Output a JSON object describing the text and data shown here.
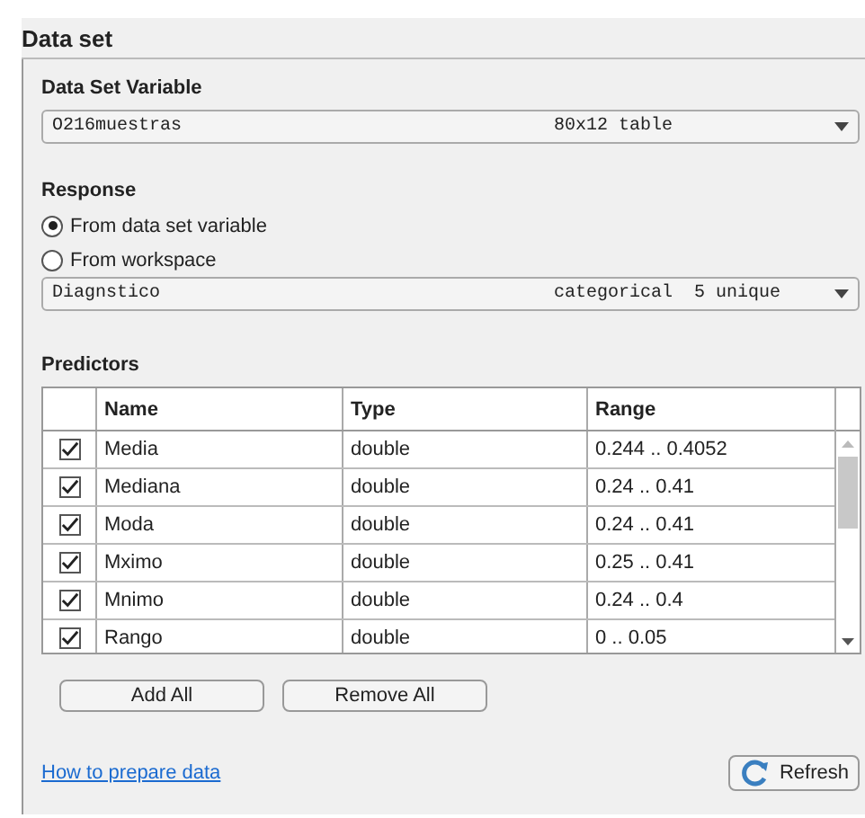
{
  "panel": {
    "title": "Data set"
  },
  "data_set_variable": {
    "label": "Data Set Variable",
    "value": "O216muestras",
    "info": "80x12 table"
  },
  "response": {
    "label": "Response",
    "options": [
      {
        "label": "From data set variable",
        "selected": true
      },
      {
        "label": "From workspace",
        "selected": false
      }
    ],
    "value": "Diagnstico",
    "info": "categorical  5 unique"
  },
  "predictors": {
    "label": "Predictors",
    "columns": [
      "Name",
      "Type",
      "Range"
    ],
    "rows": [
      {
        "checked": true,
        "name": "Media",
        "type": "double",
        "range": "0.244 .. 0.4052"
      },
      {
        "checked": true,
        "name": "Mediana",
        "type": "double",
        "range": "0.24 .. 0.41"
      },
      {
        "checked": true,
        "name": "Moda",
        "type": "double",
        "range": "0.24 .. 0.41"
      },
      {
        "checked": true,
        "name": "Mximo",
        "type": "double",
        "range": "0.25 .. 0.41"
      },
      {
        "checked": true,
        "name": "Mnimo",
        "type": "double",
        "range": "0.24 .. 0.4"
      },
      {
        "checked": true,
        "name": "Rango",
        "type": "double",
        "range": "0 .. 0.05"
      }
    ]
  },
  "buttons": [
    "Add All",
    "Remove All"
  ],
  "link": "How to prepare data",
  "refresh": "Refresh"
}
